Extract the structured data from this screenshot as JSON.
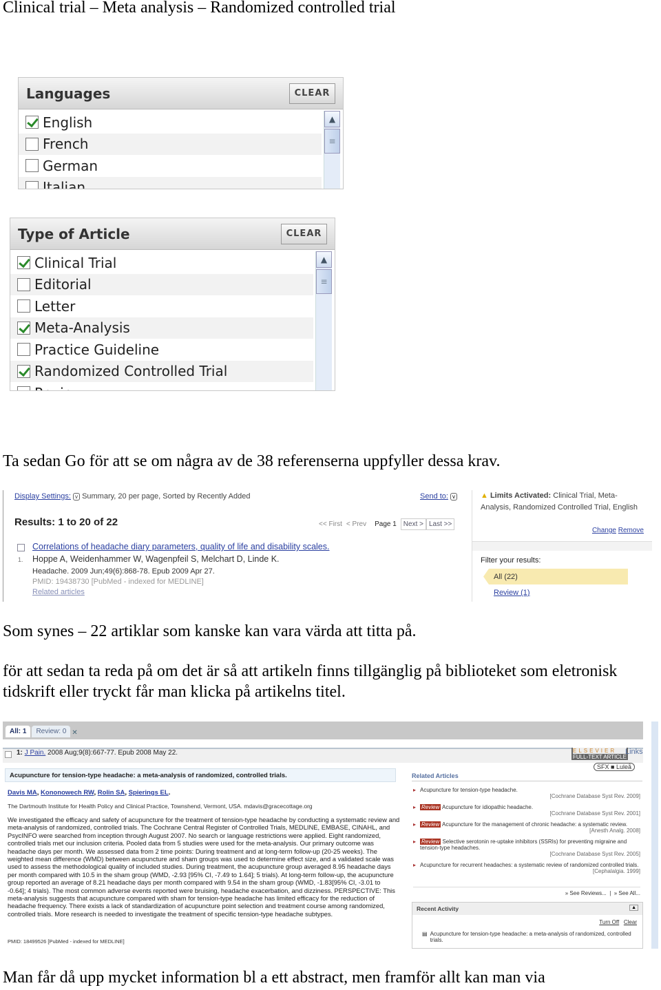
{
  "heading": "Clinical trial – Meta analysis – Randomized controlled trial",
  "languages": {
    "title": "Languages",
    "clear": "CLEAR",
    "items": [
      {
        "label": "English",
        "checked": true
      },
      {
        "label": "French",
        "checked": false
      },
      {
        "label": "German",
        "checked": false
      },
      {
        "label": "Italian",
        "checked": false
      }
    ]
  },
  "article_type": {
    "title": "Type of Article",
    "clear": "CLEAR",
    "items": [
      {
        "label": "Clinical Trial",
        "checked": true
      },
      {
        "label": "Editorial",
        "checked": false
      },
      {
        "label": "Letter",
        "checked": false
      },
      {
        "label": "Meta-Analysis",
        "checked": true
      },
      {
        "label": "Practice Guideline",
        "checked": false
      },
      {
        "label": "Randomized Controlled Trial",
        "checked": true
      },
      {
        "label": "Review",
        "checked": false
      }
    ]
  },
  "para1": "Ta sedan Go för att se om några av de 38 referenserna uppfyller dessa krav.",
  "results": {
    "display_settings": "Display Settings:",
    "display_value": "Summary, 20 per page, Sorted by Recently Added",
    "send_to": "Send to:",
    "count": "Results: 1 to 20 of 22",
    "pager": {
      "first": "<< First",
      "prev": "< Prev",
      "page": "Page 1",
      "next": "Next >",
      "last": "Last >>"
    },
    "item": {
      "num": "1.",
      "title": "Correlations of headache diary parameters, quality of life and disability scales.",
      "authors": "Hoppe A, Weidenhammer W, Wagenpfeil S, Melchart D, Linde K.",
      "citation": "Headache. 2009 Jun;49(6):868-78. Epub 2009 Apr 27.",
      "pmid": "PMID: 19438730 [PubMed - indexed for MEDLINE]",
      "related": "Related articles"
    },
    "limits": {
      "label": "Limits Activated:",
      "value": "Clinical Trial, Meta-Analysis, Randomized Controlled Trial, English",
      "change": "Change",
      "remove": "Remove"
    },
    "filter": {
      "title": "Filter your results:",
      "all": "All (22)",
      "review": "Review (1)"
    }
  },
  "para2": "Som synes – 22 artiklar som kanske kan vara värda att titta på.",
  "para3_line1": "för att sedan ta reda på om det är så att artikeln finns tillgänglig på biblioteket som eletronisk",
  "para3_line2": "tidskrift eller tryckt får man klicka på artikelns titel.",
  "abstract": {
    "tabs": [
      "All: 1",
      "Review: 0"
    ],
    "num": "1:",
    "journal": "J Pain.",
    "citation": "2008 Aug;9(8):667-77. Epub 2008 May 22.",
    "title": "Acupuncture for tension-type headache: a meta-analysis of randomized, controlled trials.",
    "authors": [
      "Davis MA",
      "Kononowech RW",
      "Rolin SA",
      "Spierings EL"
    ],
    "affiliation": "The Dartmouth Institute for Health Policy and Clinical Practice, Townshend, Vermont, USA. mdavis@gracecottage.org",
    "text": "We investigated the efficacy and safety of acupuncture for the treatment of tension-type headache by conducting a systematic review and meta-analysis of randomized, controlled trials. The Cochrane Central Register of Controlled Trials, MEDLINE, EMBASE, CINAHL, and PsycINFO were searched from inception through August 2007. No search or language restrictions were applied. Eight randomized, controlled trials met our inclusion criteria. Pooled data from 5 studies were used for the meta-analysis. Our primary outcome was headache days per month. We assessed data from 2 time points: During treatment and at long-term follow-up (20-25 weeks). The weighted mean difference (WMD) between acupuncture and sham groups was used to determine effect size, and a validated scale was used to assess the methodological quality of included studies. During treatment, the acupuncture group averaged 8.95 headache days per month compared with 10.5 in the sham group (WMD, -2.93 [95% CI, -7.49 to 1.64]; 5 trials). At long-term follow-up, the acupuncture group reported an average of 8.21 headache days per month compared with 9.54 in the sham group (WMD, -1.83[95% CI, -3.01 to -0.64]; 4 trials). The most common adverse events reported were bruising, headache exacerbation, and dizziness. PERSPECTIVE: This meta-analysis suggests that acupuncture compared with sham for tension-type headache has limited efficacy for the reduction of headache frequency. There exists a lack of standardization of acupuncture point selection and treatment course among randomized, controlled trials. More research is needed to investigate the treatment of specific tension-type headache subtypes.",
    "pmid": "PMID: 18499526 [PubMed - indexed for MEDLINE]",
    "elsevier": "ELSEVIER",
    "elsevier_sub": "FULL-TEXT ARTICLE",
    "links": "Links",
    "sfx": "SFX ■ Luleå",
    "related_title": "Related Articles",
    "related": [
      {
        "review": false,
        "title": "Acupuncture for tension-type headache.",
        "source": "[Cochrane Database Syst Rev. 2009]"
      },
      {
        "review": true,
        "title": "Acupuncture for idiopathic headache.",
        "source": "[Cochrane Database Syst Rev. 2001]"
      },
      {
        "review": true,
        "title": "Acupuncture for the management of chronic headache: a systematic review.",
        "source": "[Anesth Analg. 2008]"
      },
      {
        "review": true,
        "title": "Selective serotonin re-uptake inhibitors (SSRIs) for preventing migraine and tension-type headaches.",
        "source": "[Cochrane Database Syst Rev. 2005]"
      },
      {
        "review": false,
        "title": "Acupuncture for recurrent headaches: a systematic review of randomized controlled trials.",
        "source": "[Cephalalgia. 1999]"
      }
    ],
    "review_badge": "Review",
    "see_reviews": "» See Reviews...",
    "see_all": "» See All...",
    "recent_title": "Recent Activity",
    "turn_off": "Turn Off",
    "clear": "Clear",
    "recent_item": "Acupuncture for tension-type headache: a meta-analysis of randomized, controlled trials."
  },
  "para4": "Man får då upp mycket information bl a ett abstract, men framför allt kan man via"
}
